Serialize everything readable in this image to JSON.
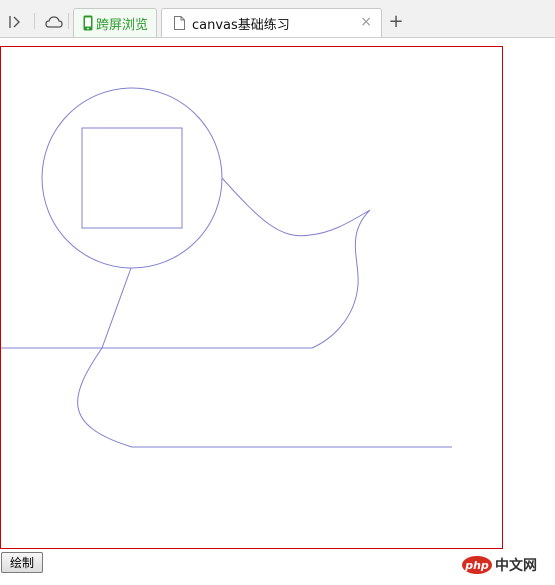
{
  "browser": {
    "tabs": [
      {
        "label": "跨屏浏览",
        "icon": "phone-icon"
      },
      {
        "label": "canvas基础练习",
        "icon": "page-icon",
        "close": "×"
      }
    ],
    "new_tab": "+"
  },
  "canvas": {
    "border_color": "#cc0000",
    "stroke_color": "#8080d0"
  },
  "button": {
    "draw_label": "绘制"
  },
  "watermark": {
    "logo_text": "php",
    "site_text": "中文网"
  }
}
